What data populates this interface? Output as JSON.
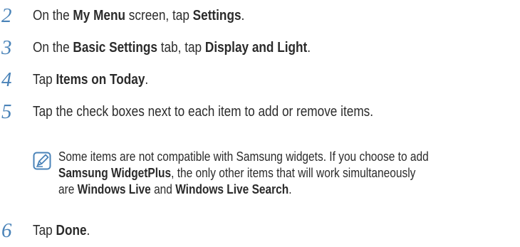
{
  "steps": [
    {
      "number": "2",
      "parts": [
        "On the ",
        "My Menu",
        " screen, tap ",
        "Settings",
        "."
      ]
    },
    {
      "number": "3",
      "parts": [
        "On the ",
        "Basic Settings",
        " tab, tap ",
        "Display and Light",
        "."
      ]
    },
    {
      "number": "4",
      "parts": [
        "Tap ",
        "Items on Today",
        "."
      ]
    },
    {
      "number": "5",
      "text": "Tap the check boxes next to each item to add or remove items."
    },
    {
      "number": "6",
      "parts": [
        "Tap ",
        "Done",
        "."
      ]
    }
  ],
  "note": {
    "icon": "note-pencil-icon",
    "line1": "Some items are not compatible with Samsung widgets. If you choose to add",
    "line2_bold": "Samsung WidgetPlus",
    "line2_rest": ", the only other items that will work simultaneously",
    "line3_pre": "are ",
    "line3_bold1": "Windows Live",
    "line3_mid": " and ",
    "line3_bold2": "Windows Live Search",
    "line3_end": "."
  },
  "colors": {
    "step_number": "#4a83b8",
    "icon": "#4a83b8",
    "text": "#2b2b2b"
  }
}
